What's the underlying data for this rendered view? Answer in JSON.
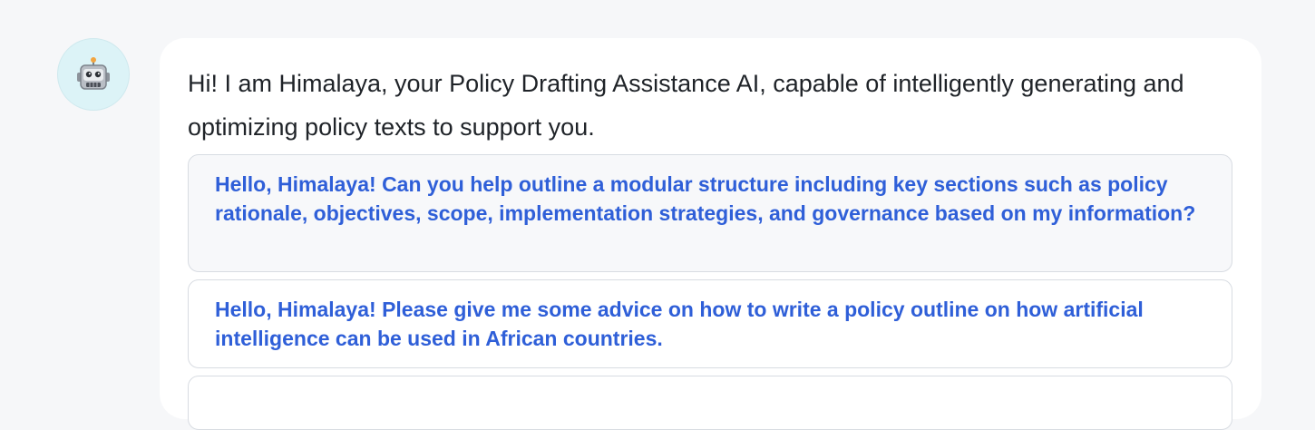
{
  "assistant": {
    "avatar_icon": "robot-icon",
    "greeting": "Hi! I am Himalaya, your Policy Drafting Assistance AI, capable of intelligently generating and optimizing policy texts to support you."
  },
  "suggestions": [
    {
      "text": "Hello, Himalaya! Can you help outline a modular structure including key sections such as policy rationale, objectives, scope, implementation strategies, and governance based on my information?"
    },
    {
      "text": "Hello, Himalaya! Please give me some advice on how to write a policy outline on how artificial intelligence can be used in African countries."
    }
  ],
  "colors": {
    "page_background": "#f6f7f9",
    "bubble_background": "#ffffff",
    "suggestion_text": "#2f5fd8",
    "avatar_background": "#dcf3f7"
  }
}
